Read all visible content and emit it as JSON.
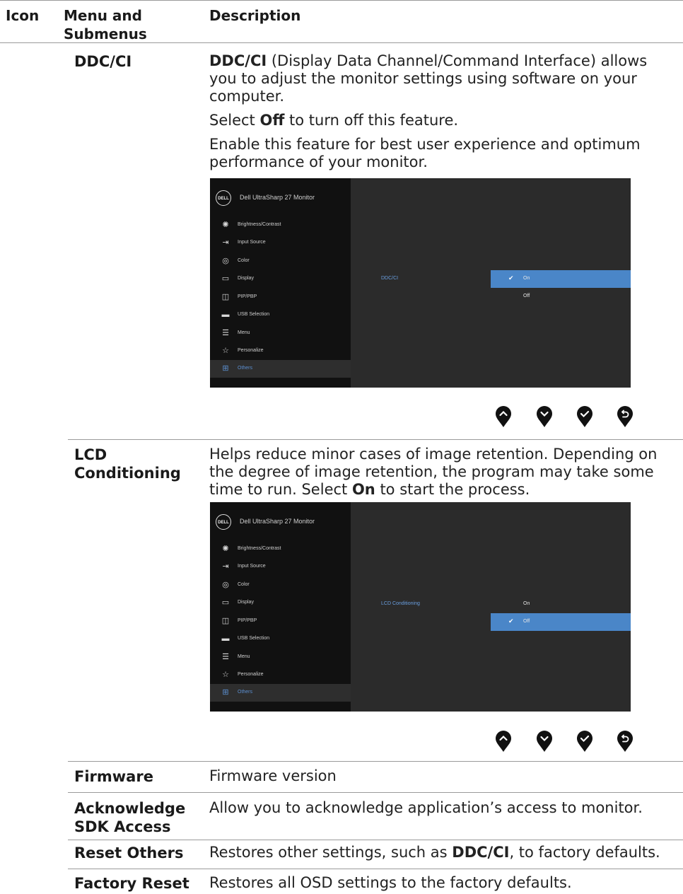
{
  "header": {
    "icon": "Icon",
    "menu": "Menu and Submenus",
    "description": "Description"
  },
  "ddc": {
    "name": "DDC/CI",
    "p1_bold": "DDC/CI",
    "p1_rest": " (Display Data Channel/Command Interface) allows you to adjust the monitor settings using software on your computer.",
    "p2_pre": "Select ",
    "p2_bold": "Off",
    "p2_post": " to turn off this feature.",
    "p3": "Enable this feature for best user experience and optimum performance of your monitor.",
    "osd": {
      "logo": "DELL",
      "title": "Dell UltraSharp 27 Monitor",
      "menu": [
        "Brightness/Contrast",
        "Input Source",
        "Color",
        "Display",
        "PIP/PBP",
        "USB Selection",
        "Menu",
        "Personalize",
        "Others"
      ],
      "selected_index": 8,
      "sub_label": "DDC/CI",
      "options": [
        "On",
        "Off"
      ],
      "highlighted_option": "On"
    }
  },
  "lcd": {
    "name": "LCD Conditioning",
    "p1_pre": "Helps reduce minor cases of image retention. Depending on the degree of image retention, the program may take some time to run. Select ",
    "p1_bold": "On",
    "p1_post": " to start the process.",
    "osd": {
      "logo": "DELL",
      "title": "Dell UltraSharp 27 Monitor",
      "menu": [
        "Brightness/Contrast",
        "Input Source",
        "Color",
        "Display",
        "PIP/PBP",
        "USB Selection",
        "Menu",
        "Personalize",
        "Others"
      ],
      "selected_index": 8,
      "sub_label": "LCD Conditioning",
      "options": [
        "On",
        "Off"
      ],
      "highlighted_option": "Off"
    }
  },
  "nav_buttons": [
    "up-icon",
    "down-icon",
    "check-icon",
    "back-icon"
  ],
  "rows": [
    {
      "name": "Firmware",
      "desc": "Firmware version"
    },
    {
      "name": "Acknowledge SDK Access",
      "desc": "Allow you to acknowledge application’s access to monitor."
    },
    {
      "name": "Reset Others",
      "desc_pre": "Restores other settings, such as ",
      "desc_bold": "DDC/CI",
      "desc_post": ", to factory defaults."
    },
    {
      "name": "Factory Reset",
      "desc": "Restores all OSD settings to the factory defaults."
    }
  ],
  "colors": {
    "accent": "#4a86c8",
    "osd_bg": "#2b2b2b",
    "osd_menu_bg": "#111111"
  }
}
